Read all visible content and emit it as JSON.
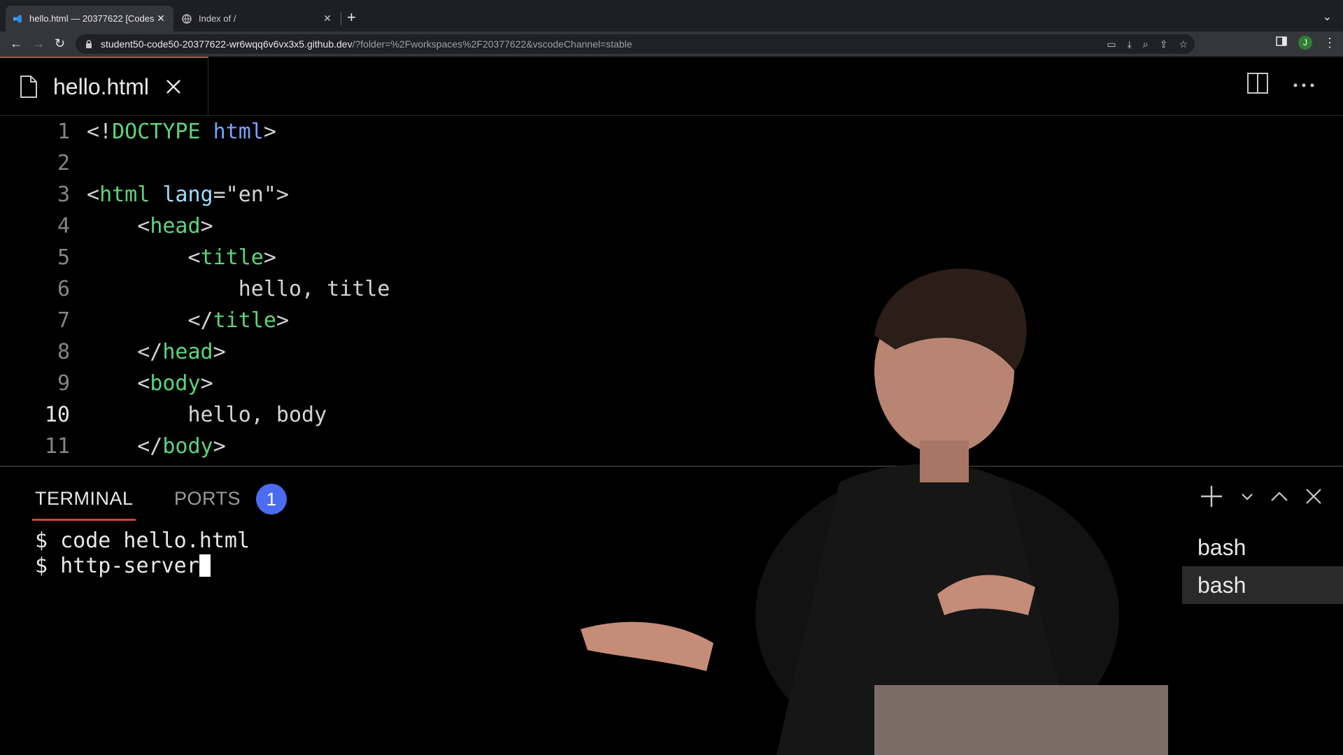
{
  "browser": {
    "tabs": [
      {
        "title": "hello.html — 20377622 [Codes",
        "active": true
      },
      {
        "title": "Index of /",
        "active": false
      }
    ],
    "url_host": "student50-code50-20377622-wr6wqq6v6vx3x5.github.dev",
    "url_path": "/?folder=%2Fworkspaces%2F20377622&vscodeChannel=stable",
    "avatar_letter": "J"
  },
  "editor": {
    "file_tab": "hello.html",
    "current_line": 10,
    "lines": [
      {
        "n": "1",
        "tokens": [
          {
            "t": "<!",
            "c": "txt"
          },
          {
            "t": "DOCTYPE",
            "c": "tagc"
          },
          {
            "t": " ",
            "c": "txt"
          },
          {
            "t": "html",
            "c": "kwc"
          },
          {
            "t": ">",
            "c": "txt"
          }
        ]
      },
      {
        "n": "2",
        "tokens": []
      },
      {
        "n": "3",
        "tokens": [
          {
            "t": "<",
            "c": "txt"
          },
          {
            "t": "html",
            "c": "tagc"
          },
          {
            "t": " ",
            "c": "txt"
          },
          {
            "t": "lang",
            "c": "attrc"
          },
          {
            "t": "=\"en\">",
            "c": "txt"
          }
        ]
      },
      {
        "n": "4",
        "tokens": [
          {
            "t": "    <",
            "c": "txt"
          },
          {
            "t": "head",
            "c": "tagc"
          },
          {
            "t": ">",
            "c": "txt"
          }
        ]
      },
      {
        "n": "5",
        "tokens": [
          {
            "t": "        <",
            "c": "txt"
          },
          {
            "t": "title",
            "c": "tagc"
          },
          {
            "t": ">",
            "c": "txt"
          }
        ]
      },
      {
        "n": "6",
        "tokens": [
          {
            "t": "            hello, title",
            "c": "txt"
          }
        ]
      },
      {
        "n": "7",
        "tokens": [
          {
            "t": "        </",
            "c": "txt"
          },
          {
            "t": "title",
            "c": "tagc"
          },
          {
            "t": ">",
            "c": "txt"
          }
        ]
      },
      {
        "n": "8",
        "tokens": [
          {
            "t": "    </",
            "c": "txt"
          },
          {
            "t": "head",
            "c": "tagc"
          },
          {
            "t": ">",
            "c": "txt"
          }
        ]
      },
      {
        "n": "9",
        "tokens": [
          {
            "t": "    <",
            "c": "txt"
          },
          {
            "t": "body",
            "c": "tagc"
          },
          {
            "t": ">",
            "c": "txt"
          }
        ]
      },
      {
        "n": "10",
        "tokens": [
          {
            "t": "        hello, body",
            "c": "txt"
          }
        ]
      },
      {
        "n": "11",
        "tokens": [
          {
            "t": "    </",
            "c": "txt"
          },
          {
            "t": "body",
            "c": "tagc"
          },
          {
            "t": ">",
            "c": "txt"
          }
        ]
      }
    ]
  },
  "panel": {
    "tabs": [
      "TERMINAL",
      "PORTS"
    ],
    "ports_badge": "1",
    "terminal_lines": [
      "$ code hello.html",
      "$ http-server"
    ],
    "sessions": [
      "bash",
      "bash"
    ]
  },
  "colors": {
    "accent": "#c9483f",
    "badge": "#4c6cf0",
    "tag": "#5ed47a",
    "attr": "#9cdcfe"
  }
}
